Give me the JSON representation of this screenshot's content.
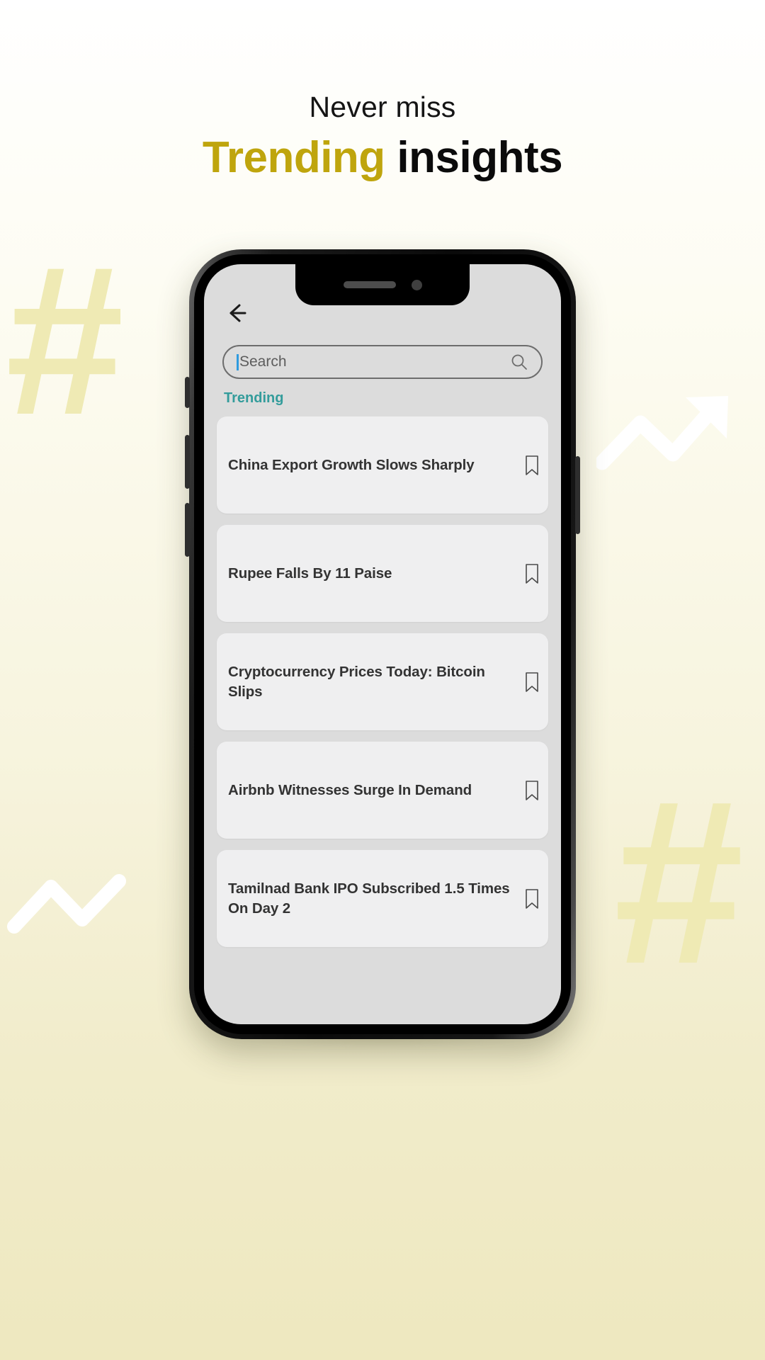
{
  "headline": {
    "line1": "Never miss",
    "line2_highlight": "Trending",
    "line2_rest": " insights",
    "highlight_color": "#bfa50d",
    "rest_color": "#0b0b0b"
  },
  "decor": {
    "hash_left": "#",
    "hash_right": "#",
    "hash_color": "#efeab4",
    "arrow_color": "#ffffff"
  },
  "phone": {
    "notch": {
      "speaker": "speaker-grille",
      "camera": "front-camera"
    }
  },
  "app": {
    "back_label": "←",
    "search": {
      "placeholder": "Search",
      "value": "",
      "icon": "search-icon",
      "caret_color": "#2f9bdf"
    },
    "section": {
      "label": "Trending",
      "color": "#339c9b"
    },
    "cards": [
      {
        "title": "China Export Growth Slows Sharply",
        "bookmark": "bookmark-icon"
      },
      {
        "title": "Rupee Falls By 11 Paise",
        "bookmark": "bookmark-icon"
      },
      {
        "title": "Cryptocurrency Prices Today: Bitcoin Slips",
        "bookmark": "bookmark-icon"
      },
      {
        "title": "Airbnb Witnesses Surge In Demand",
        "bookmark": "bookmark-icon"
      },
      {
        "title": "Tamilnad Bank IPO Subscribed 1.5 Times On Day 2",
        "bookmark": "bookmark-icon"
      }
    ]
  }
}
